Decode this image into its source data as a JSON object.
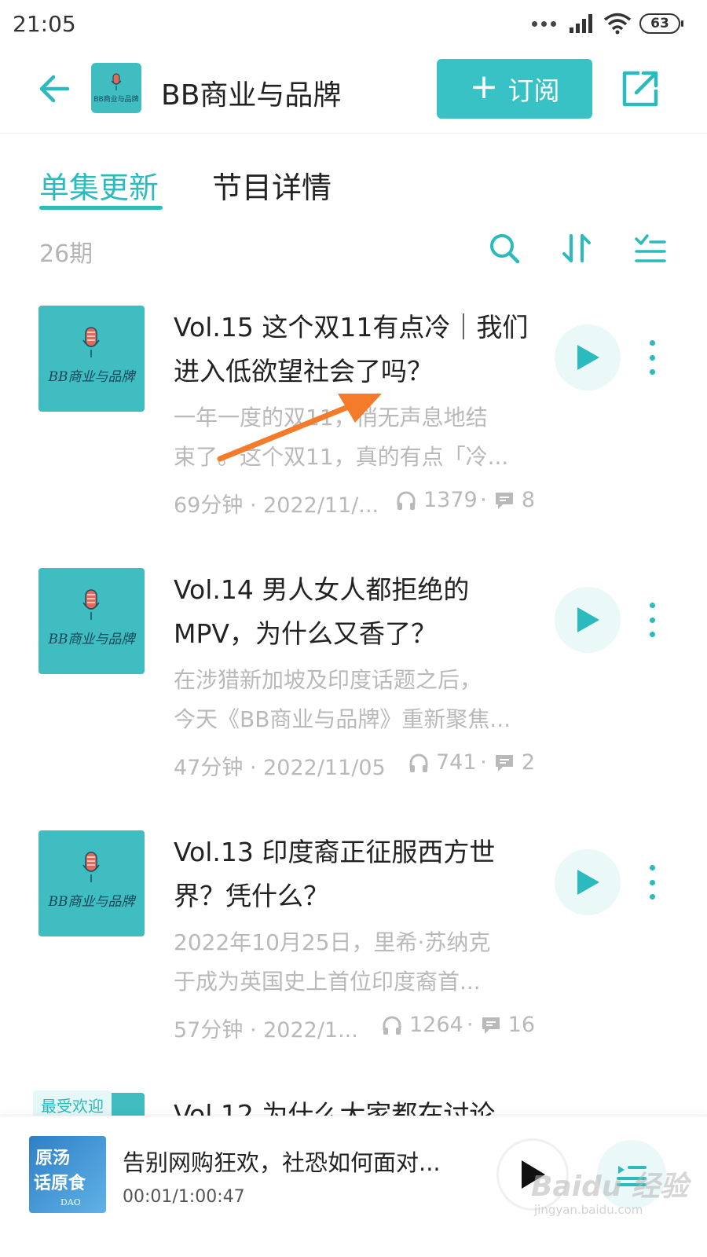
{
  "status_bar": {
    "time": "21:05",
    "battery": "63"
  },
  "header": {
    "title": "BB商业与品牌",
    "subscribe_label": "订阅",
    "cover_text": "BB商业与品牌"
  },
  "tabs": [
    {
      "label": "单集更新",
      "active": true
    },
    {
      "label": "节目详情",
      "active": false
    }
  ],
  "episode_count": "26期",
  "episodes": [
    {
      "title": "Vol.15 这个双11有点冷｜我们进入低欲望社会了吗？",
      "desc": "一年一度的双11，悄无声息地结\n束了。这个双11，真的有点「冷...",
      "duration_date": "69分钟 · 2022/11/...",
      "listens": "1379",
      "comments": "8",
      "cover_text": "BB商业与品牌"
    },
    {
      "title": "Vol.14 男人女人都拒绝的MPV，为什么又香了？",
      "desc": "在涉猎新加坡及印度话题之后，\n今天《BB商业与品牌》重新聚焦...",
      "duration_date": "47分钟 · 2022/11/05",
      "listens": "741",
      "comments": "2",
      "cover_text": "BB商业与品牌"
    },
    {
      "title": "Vol.13 印度裔正征服西方世界？凭什么？",
      "desc": "2022年10月25日，里希·苏纳克\n于成为英国史上首位印度裔首...",
      "duration_date": "57分钟 · 2022/1...",
      "listens": "1264",
      "comments": "16",
      "cover_text": "BB商业与品牌"
    },
    {
      "title": "Vol.12 为什么大家都在讨论",
      "badge": "最受欢迎"
    }
  ],
  "player": {
    "title": "告别网购狂欢，社恐如何面对...",
    "time": "00:01/1:00:47",
    "cover_text_1": "原汤",
    "cover_text_2": "话原食",
    "cover_text_3": "DAO"
  },
  "watermark": {
    "main": "Baidu 经验",
    "sub": "jingyan.baidu.com"
  },
  "colors": {
    "accent": "#2bbabd",
    "button": "#38c2c6",
    "cover": "#3fbdc0",
    "arrow": "#f47b2a"
  }
}
